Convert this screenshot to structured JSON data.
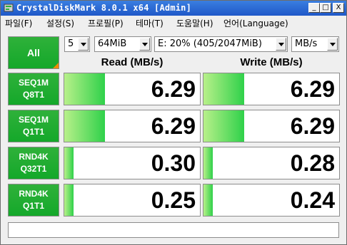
{
  "window": {
    "title": "CrystalDiskMark 8.0.1 x64 [Admin]",
    "controls": {
      "minimize": "_",
      "maximize": "□",
      "close": "X"
    }
  },
  "menu": [
    "파일(F)",
    "설정(S)",
    "프로필(P)",
    "테마(T)",
    "도움말(H)",
    "언어(Language)"
  ],
  "controls": {
    "all_label": "All",
    "count": "5",
    "size": "64MiB",
    "drive": "E: 20% (405/2047MiB)",
    "unit": "MB/s"
  },
  "headers": {
    "read": "Read (MB/s)",
    "write": "Write (MB/s)"
  },
  "tests": [
    {
      "line1": "SEQ1M",
      "line2": "Q8T1",
      "read": "6.29",
      "write": "6.29",
      "read_fill": 0.3,
      "write_fill": 0.3
    },
    {
      "line1": "SEQ1M",
      "line2": "Q1T1",
      "read": "6.29",
      "write": "6.29",
      "read_fill": 0.3,
      "write_fill": 0.3
    },
    {
      "line1": "RND4K",
      "line2": "Q32T1",
      "read": "0.30",
      "write": "0.28",
      "read_fill": 0.07,
      "write_fill": 0.07
    },
    {
      "line1": "RND4K",
      "line2": "Q1T1",
      "read": "0.25",
      "write": "0.24",
      "read_fill": 0.07,
      "write_fill": 0.07
    }
  ],
  "colors": {
    "accent_green": "#14a82a",
    "title_blue": "#1f58c8",
    "corner_orange": "#f08a00"
  }
}
